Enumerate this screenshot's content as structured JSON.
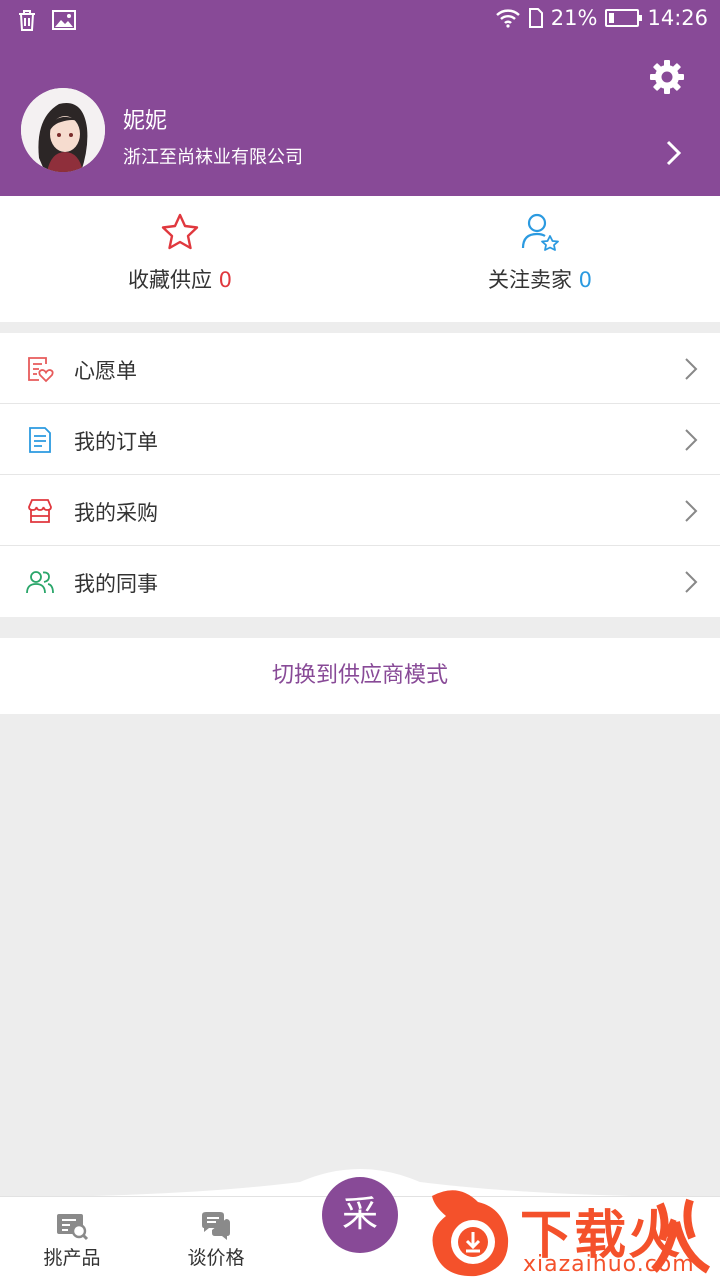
{
  "status_bar": {
    "battery": "21%",
    "time": "14:26",
    "battery_level": 0.21
  },
  "profile": {
    "name": "妮妮",
    "company": "浙江至尚袜业有限公司"
  },
  "favorites": [
    {
      "label": "收藏供应",
      "count": "0",
      "icon": "star-icon"
    },
    {
      "label": "关注卖家",
      "count": "0",
      "icon": "user-star-icon"
    }
  ],
  "menu": [
    {
      "label": "心愿单",
      "icon": "wishlist-icon"
    },
    {
      "label": "我的订单",
      "icon": "order-icon"
    },
    {
      "label": "我的采购",
      "icon": "purchase-icon"
    },
    {
      "label": "我的同事",
      "icon": "colleagues-icon"
    }
  ],
  "switch_mode": "切换到供应商模式",
  "bottom_nav": {
    "items": [
      {
        "label": "挑产品",
        "icon": "search-products-icon"
      },
      {
        "label": "谈价格",
        "icon": "chat-price-icon"
      }
    ],
    "center": "采"
  },
  "watermark": {
    "text": "下载火",
    "url": "xiazaihuo.com"
  },
  "colors": {
    "brand": "#884a97",
    "count_red": "#e0383e",
    "count_blue": "#2b9ae0"
  }
}
